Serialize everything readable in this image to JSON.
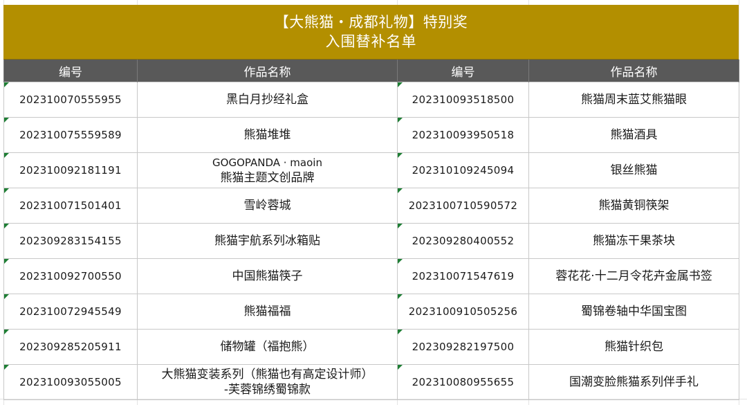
{
  "title": {
    "line1": "【大熊猫・成都礼物】特别奖",
    "line2": "入围替补名单"
  },
  "headers": [
    "编号",
    "作品名称",
    "编号",
    "作品名称"
  ],
  "rows": [
    {
      "left_id": "202310070555955",
      "left_name": "黑白月抄经礼盒",
      "right_id": "202310093518500",
      "right_name": "熊猫周末蓝艾熊猫眼"
    },
    {
      "left_id": "202310075559589",
      "left_name": "熊猫堆堆",
      "right_id": "202310093950518",
      "right_name": "熊猫酒具"
    },
    {
      "left_id": "202310092181191",
      "left_name_line1": "GOGOPANDA · maoin",
      "left_name_line2": "熊猫主题文创品牌",
      "right_id": "202310109245094",
      "right_name": "银丝熊猫"
    },
    {
      "left_id": "202310071501401",
      "left_name": "雪岭蓉城",
      "right_id": "2023100710590572",
      "right_name": "熊猫黄铜筷架"
    },
    {
      "left_id": "202309283154155",
      "left_name": "熊猫宇航系列冰箱贴",
      "right_id": "202309280400552",
      "right_name": "熊猫冻干果茶块"
    },
    {
      "left_id": "202310092700550",
      "left_name": "中国熊猫筷子",
      "right_id": "202310071547619",
      "right_name": "蓉花花·十二月令花卉金属书签"
    },
    {
      "left_id": "202310072945549",
      "left_name": "熊猫福福",
      "right_id": "2023100910505256",
      "right_name": "蜀锦卷轴中华国宝图"
    },
    {
      "left_id": "202309285205911",
      "left_name": "储物罐（福抱熊）",
      "right_id": "202309282197500",
      "right_name": "熊猫针织包"
    },
    {
      "left_id": "202310093055005",
      "left_name_line1": "大熊猫变装系列（熊猫也有高定设计师）",
      "left_name_line2": "-芙蓉锦绣蜀锦款",
      "right_id": "202310080955655",
      "right_name": "国潮变脸熊猫系列伴手礼"
    }
  ]
}
